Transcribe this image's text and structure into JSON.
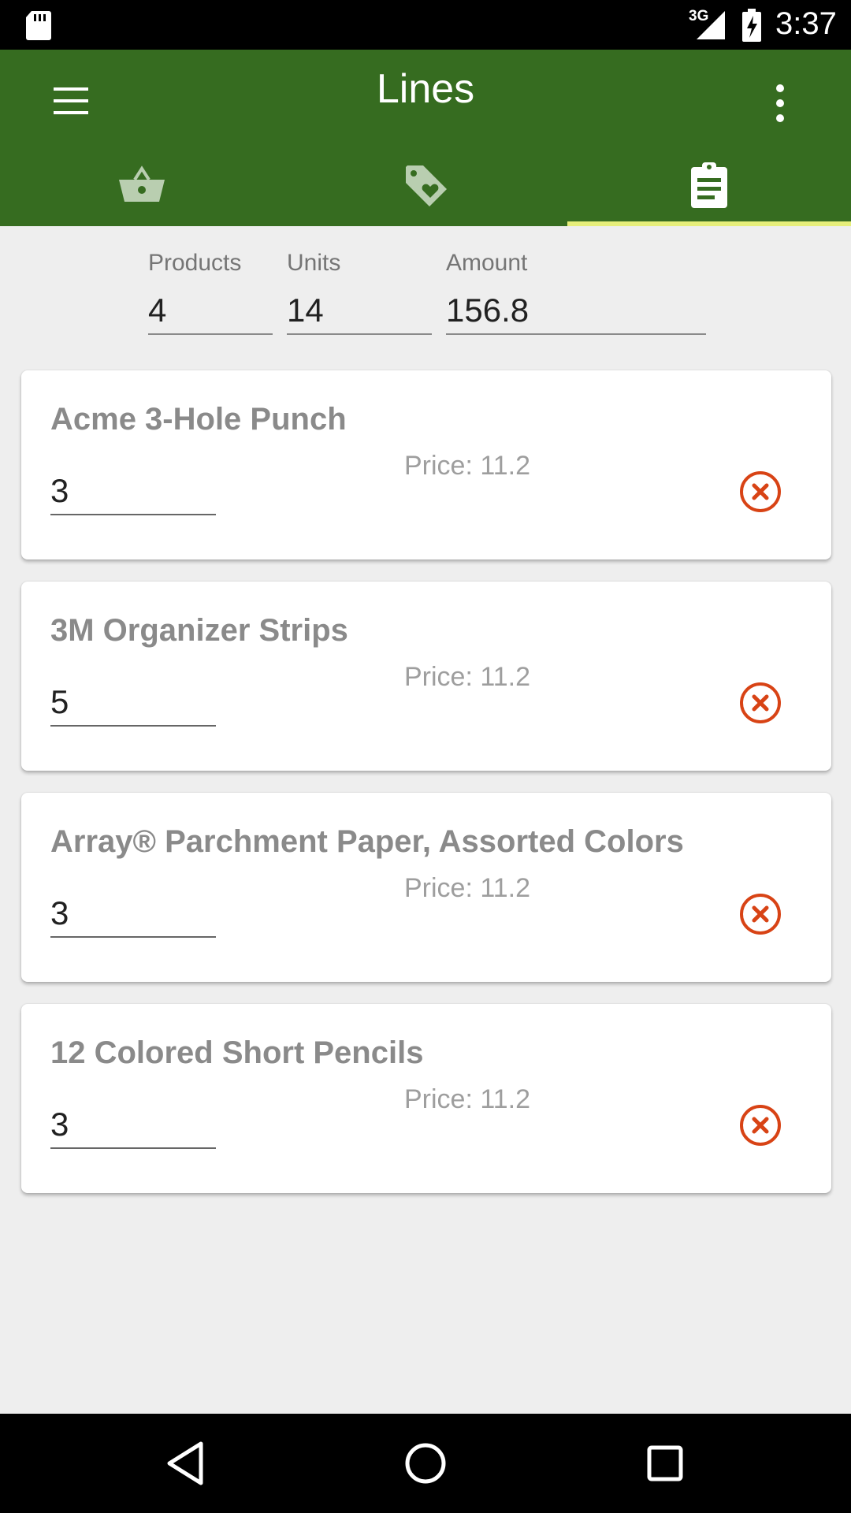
{
  "status_bar": {
    "network": "3G",
    "time": "3:37",
    "icons": [
      "sd-card-icon",
      "signal-icon",
      "battery-charging-icon"
    ]
  },
  "app_bar": {
    "title": "Lines",
    "menu_icon": "hamburger-menu-icon",
    "overflow_icon": "more-vert-icon",
    "color": "#366c20",
    "indicator_color": "#e6ee7a"
  },
  "tabs": [
    {
      "name": "basket",
      "icon": "basket-icon",
      "selected": false
    },
    {
      "name": "tag",
      "icon": "tag-heart-icon",
      "selected": false
    },
    {
      "name": "lines",
      "icon": "clipboard-list-icon",
      "selected": true
    }
  ],
  "totals": {
    "products_label": "Products",
    "products_value": "4",
    "units_label": "Units",
    "units_value": "14",
    "amount_label": "Amount",
    "amount_value": "156.8"
  },
  "lines": [
    {
      "name": "Acme 3-Hole Punch",
      "price": "Price: 11.2",
      "quantity": "3"
    },
    {
      "name": "3M Organizer Strips",
      "price": "Price: 11.2",
      "quantity": "5"
    },
    {
      "name": "Array® Parchment Paper, Assorted Colors",
      "price": "Price: 11.2",
      "quantity": "3"
    },
    {
      "name": "12 Colored Short Pencils",
      "price": "Price: 11.2",
      "quantity": "3"
    }
  ],
  "remove_icon": "remove-circle-icon",
  "remove_color": "#d84315",
  "nav_bar": {
    "icons": [
      "back-icon",
      "home-icon",
      "recents-icon"
    ]
  }
}
